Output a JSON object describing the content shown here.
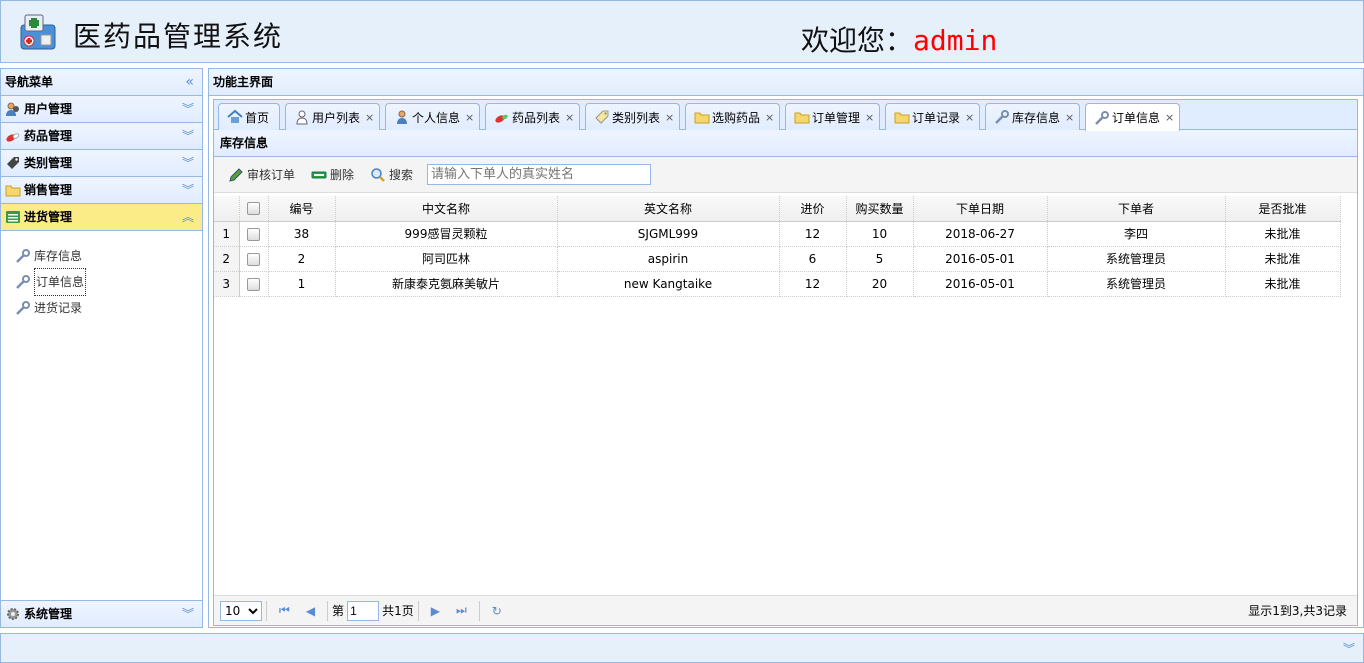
{
  "header": {
    "app_title": "医药品管理系统",
    "welcome_prefix": "欢迎您：",
    "username": "admin"
  },
  "west": {
    "title": "导航菜单",
    "sections": [
      {
        "label": "用户管理",
        "icon": "user-icon"
      },
      {
        "label": "药品管理",
        "icon": "pill-icon"
      },
      {
        "label": "类别管理",
        "icon": "tag-icon"
      },
      {
        "label": "销售管理",
        "icon": "folder-icon"
      },
      {
        "label": "进货管理",
        "icon": "list-icon",
        "selected": true
      }
    ],
    "items": [
      {
        "label": "库存信息",
        "icon": "wrench-icon"
      },
      {
        "label": "订单信息",
        "icon": "wrench-icon",
        "active": true
      },
      {
        "label": "进货记录",
        "icon": "wrench-icon"
      }
    ],
    "bottom_section": {
      "label": "系统管理",
      "icon": "gear-icon"
    }
  },
  "center": {
    "title": "功能主界面",
    "tabs": [
      {
        "label": "首页",
        "icon": "home-icon",
        "closable": false
      },
      {
        "label": "用户列表",
        "icon": "users-icon",
        "closable": true
      },
      {
        "label": "个人信息",
        "icon": "user-icon",
        "closable": true
      },
      {
        "label": "药品列表",
        "icon": "pill-icon",
        "closable": true
      },
      {
        "label": "类别列表",
        "icon": "tag-icon",
        "closable": true
      },
      {
        "label": "选购药品",
        "icon": "folder-icon",
        "closable": true
      },
      {
        "label": "订单管理",
        "icon": "folder-icon",
        "closable": true
      },
      {
        "label": "订单记录",
        "icon": "folder-icon",
        "closable": true
      },
      {
        "label": "库存信息",
        "icon": "wrench-icon",
        "closable": true
      },
      {
        "label": "订单信息",
        "icon": "wrench-icon",
        "closable": true,
        "active": true
      }
    ],
    "close_glyph": "×",
    "panel_title": "库存信息",
    "toolbar": {
      "approve_label": "审核订单",
      "delete_label": "删除",
      "search_label": "搜索",
      "search_placeholder": "请输入下单人的真实姓名"
    },
    "grid": {
      "columns": [
        "编号",
        "中文名称",
        "英文名称",
        "进价",
        "购买数量",
        "下单日期",
        "下单者",
        "是否批准"
      ],
      "rows": [
        {
          "rownum": "1",
          "id": "38",
          "cn_name": "999感冒灵颗粒",
          "en_name": "SJGML999",
          "price": "12",
          "qty": "10",
          "date": "2018-06-27",
          "buyer": "李四",
          "approved": "未批准"
        },
        {
          "rownum": "2",
          "id": "2",
          "cn_name": "阿司匹林",
          "en_name": "aspirin",
          "price": "6",
          "qty": "5",
          "date": "2016-05-01",
          "buyer": "系统管理员",
          "approved": "未批准"
        },
        {
          "rownum": "3",
          "id": "1",
          "cn_name": "新康泰克氨麻美敏片",
          "en_name": "new Kangtaike",
          "price": "12",
          "qty": "20",
          "date": "2016-05-01",
          "buyer": "系统管理员",
          "approved": "未批准"
        }
      ]
    },
    "pager": {
      "page_size": "10",
      "page_prefix": "第",
      "page_value": "1",
      "page_total": "共1页",
      "info": "显示1到3,共3记录"
    }
  },
  "colors": {
    "border": "#95b8e7",
    "header_bg": "#e6f0fb",
    "selected_section": "#fbec88",
    "username": "#ff0000"
  }
}
